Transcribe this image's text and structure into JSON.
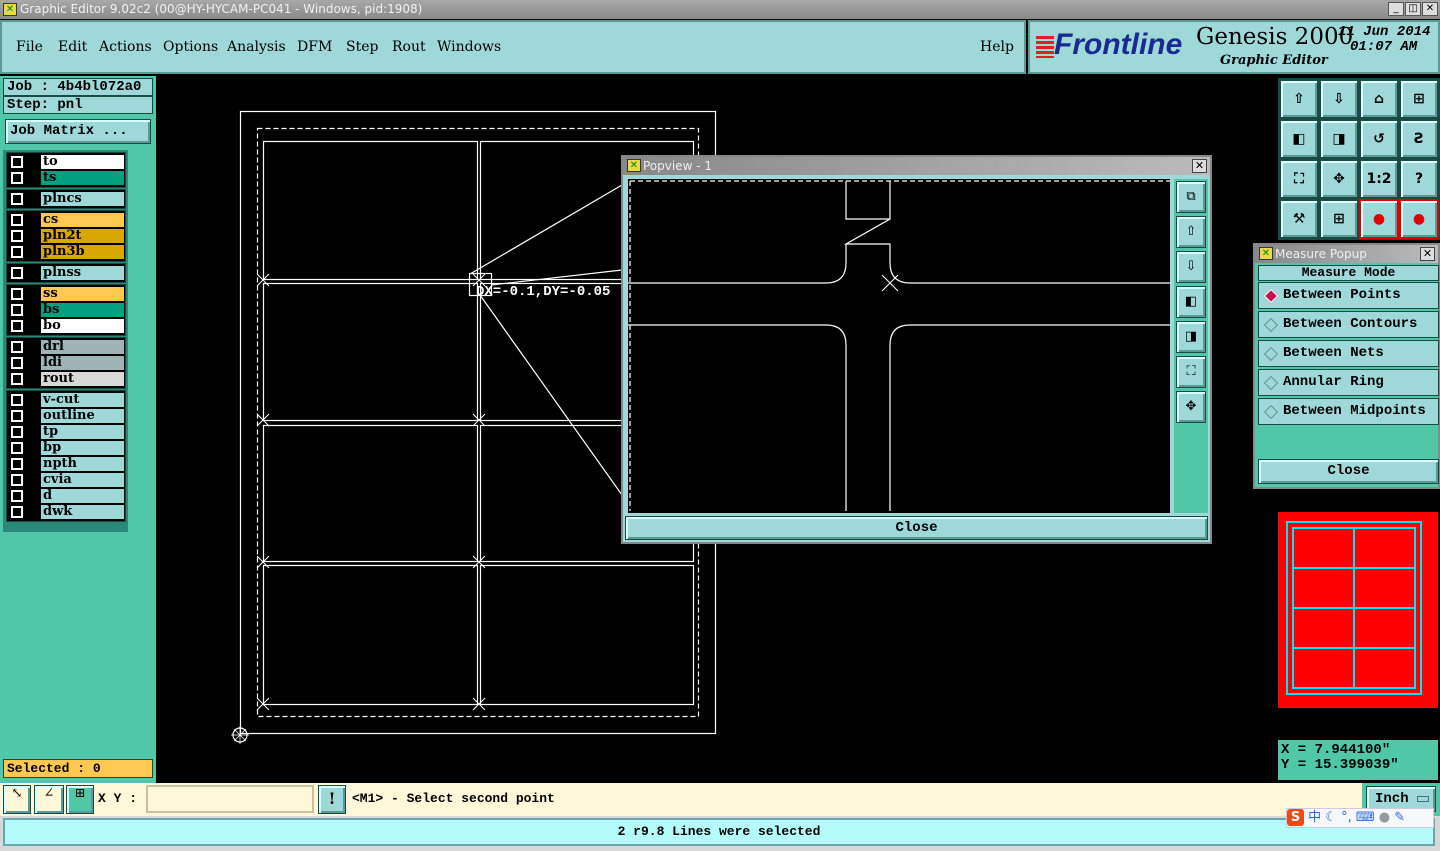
{
  "window": {
    "title": "Graphic Editor 9.02c2 (00@HY-HYCAM-PC041 - Windows, pid:1908)",
    "minimize": "_",
    "restore": "🗗",
    "close": "✕"
  },
  "menu": {
    "items": [
      "File",
      "Edit",
      "Actions",
      "Options",
      "Analysis",
      "DFM",
      "Step",
      "Rout",
      "Windows"
    ],
    "help": "Help"
  },
  "logo": {
    "brand": "Frontline",
    "product": "Genesis 2000",
    "subtitle": "Graphic Editor",
    "date": "11 Jun 2014",
    "time": "01:07 AM"
  },
  "job": {
    "job": "Job : 4b4bl072a0",
    "step": "Step: pnl",
    "matrix_button": "Job Matrix ..."
  },
  "layers": [
    {
      "name": "to",
      "color": "#ffffff"
    },
    {
      "name": "ts",
      "color": "#00a080"
    },
    {
      "name": "plncs",
      "color": "#9ed8d8"
    },
    {
      "name": "cs",
      "color": "#ffc850"
    },
    {
      "name": "pln2t",
      "color": "#d8a800"
    },
    {
      "name": "pln3b",
      "color": "#d8a800"
    },
    {
      "name": "plnss",
      "color": "#9ed8d8"
    },
    {
      "name": "ss",
      "color": "#ffc850"
    },
    {
      "name": "bs",
      "color": "#00a080"
    },
    {
      "name": "bo",
      "color": "#ffffff"
    },
    {
      "name": "drl",
      "color": "#a0b4b8"
    },
    {
      "name": "ldi",
      "color": "#a0b4b8"
    },
    {
      "name": "rout",
      "color": "#d8d8d8"
    },
    {
      "name": "v-cut",
      "color": "#9ed8d8"
    },
    {
      "name": "outline",
      "color": "#9ed8d8"
    },
    {
      "name": "tp",
      "color": "#9ed8d8"
    },
    {
      "name": "bp",
      "color": "#9ed8d8"
    },
    {
      "name": "npth",
      "color": "#9ed8d8"
    },
    {
      "name": "cvia",
      "color": "#9ed8d8"
    },
    {
      "name": "d",
      "color": "#9ed8d8"
    },
    {
      "name": "dwk",
      "color": "#9ed8d8"
    }
  ],
  "selected": "Selected : 0",
  "canvas": {
    "measure_label": "DX=-0.1,DY=-0.05"
  },
  "toolbar": {
    "icons": [
      "zoom-in-icon",
      "zoom-out-icon",
      "home-icon",
      "grid-xy-icon",
      "pan-left-icon",
      "pan-right-icon",
      "undo-view-icon",
      "snap-icon",
      "fit-all-icon",
      "fit-center-icon",
      "scale-icon",
      "help-icon",
      "tools-icon",
      "multi-view-icon",
      "net-red-icon",
      "net-black-icon"
    ],
    "scale_label": "1:2",
    "help_label": "?"
  },
  "popview": {
    "title": "Popview - 1",
    "close": "Close"
  },
  "measure": {
    "title": "Measure Popup",
    "mode_label": "Measure Mode",
    "options": [
      "Between Points",
      "Between Contours",
      "Between Nets",
      "Annular Ring",
      "Between Midpoints"
    ],
    "selected": "Between Points",
    "close": "Close"
  },
  "coords": {
    "x": "X  = 7.944100\"",
    "y": "Y  = 15.399039\""
  },
  "bottom": {
    "xy_label": "X Y :",
    "xy_value": "",
    "message": "<M1> - Select second point",
    "units": "Inch",
    "status": "2 r9.8 Lines were selected",
    "ime": "中"
  },
  "colors": {
    "teal": "#50c8a8",
    "cyan": "#9ed8d8",
    "selected_bg": "#ffc850",
    "minimap_fill": "#ff0000",
    "minimap_lines": "#00e0ff"
  }
}
